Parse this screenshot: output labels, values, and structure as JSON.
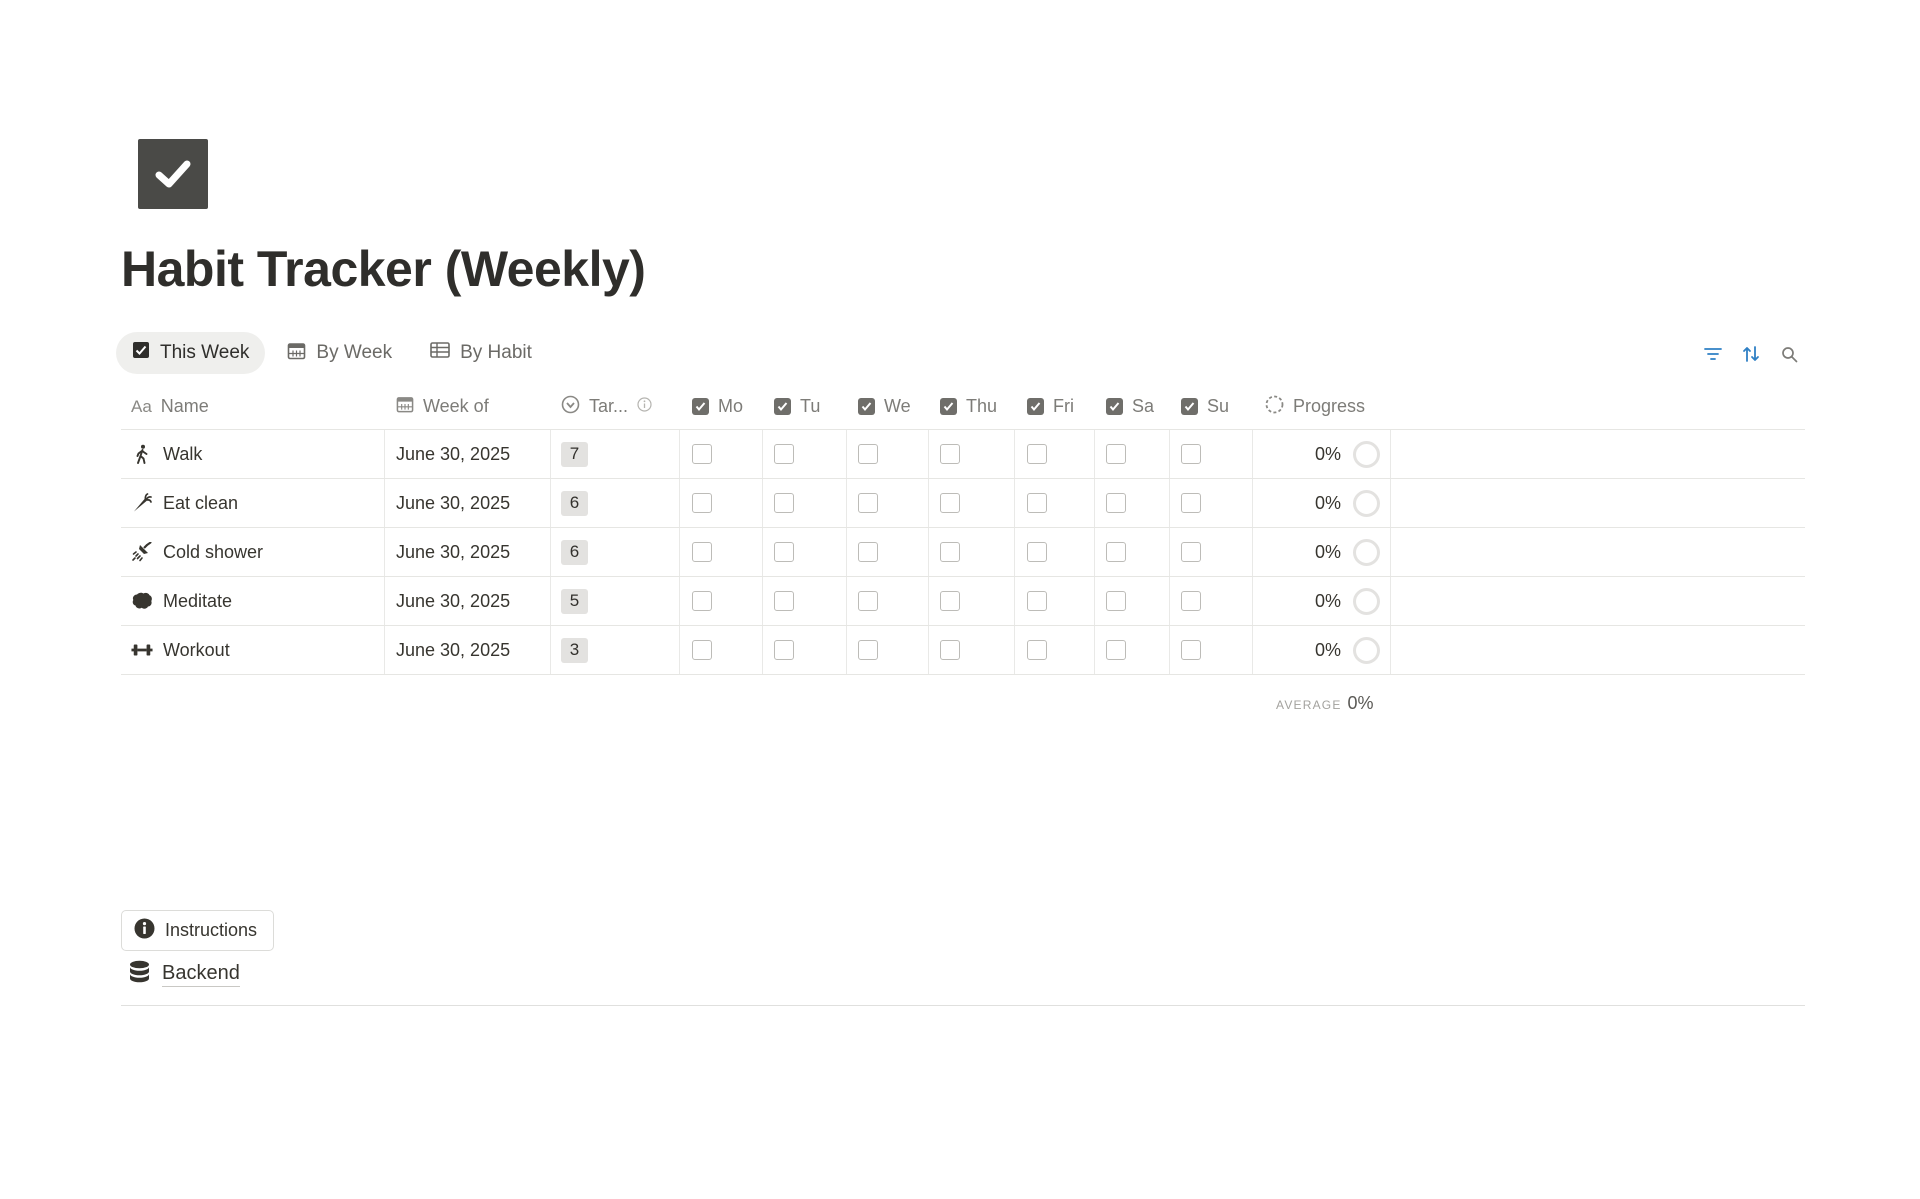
{
  "page": {
    "title": "Habit Tracker (Weekly)",
    "icon": "checkbox-icon"
  },
  "tabs": [
    {
      "label": "This Week",
      "icon": "checkbox-icon",
      "active": true
    },
    {
      "label": "By Week",
      "icon": "calendar-icon",
      "active": false
    },
    {
      "label": "By Habit",
      "icon": "table-icon",
      "active": false
    }
  ],
  "toolbar": {
    "icons": [
      "filter-icon",
      "sort-icon",
      "search-icon"
    ],
    "accent": "#2f80c5"
  },
  "table": {
    "columns": {
      "name": "Name",
      "week": "Week of",
      "target": "Tar...",
      "mo": "Mo",
      "tu": "Tu",
      "we": "We",
      "thu": "Thu",
      "fri": "Fri",
      "sa": "Sa",
      "su": "Su",
      "progress": "Progress"
    },
    "rows": [
      {
        "icon": "walk-icon",
        "name": "Walk",
        "week": "June 30, 2025",
        "target": "7",
        "progress": "0%"
      },
      {
        "icon": "carrot-icon",
        "name": "Eat clean",
        "week": "June 30, 2025",
        "target": "6",
        "progress": "0%"
      },
      {
        "icon": "shower-icon",
        "name": "Cold shower",
        "week": "June 30, 2025",
        "target": "6",
        "progress": "0%"
      },
      {
        "icon": "brain-icon",
        "name": "Meditate",
        "week": "June 30, 2025",
        "target": "5",
        "progress": "0%"
      },
      {
        "icon": "dumbbell-icon",
        "name": "Workout",
        "week": "June 30, 2025",
        "target": "3",
        "progress": "0%"
      }
    ],
    "average": {
      "label": "AVERAGE",
      "value": "0%"
    }
  },
  "footer": {
    "instructions_label": "Instructions",
    "backend_label": "Backend"
  }
}
